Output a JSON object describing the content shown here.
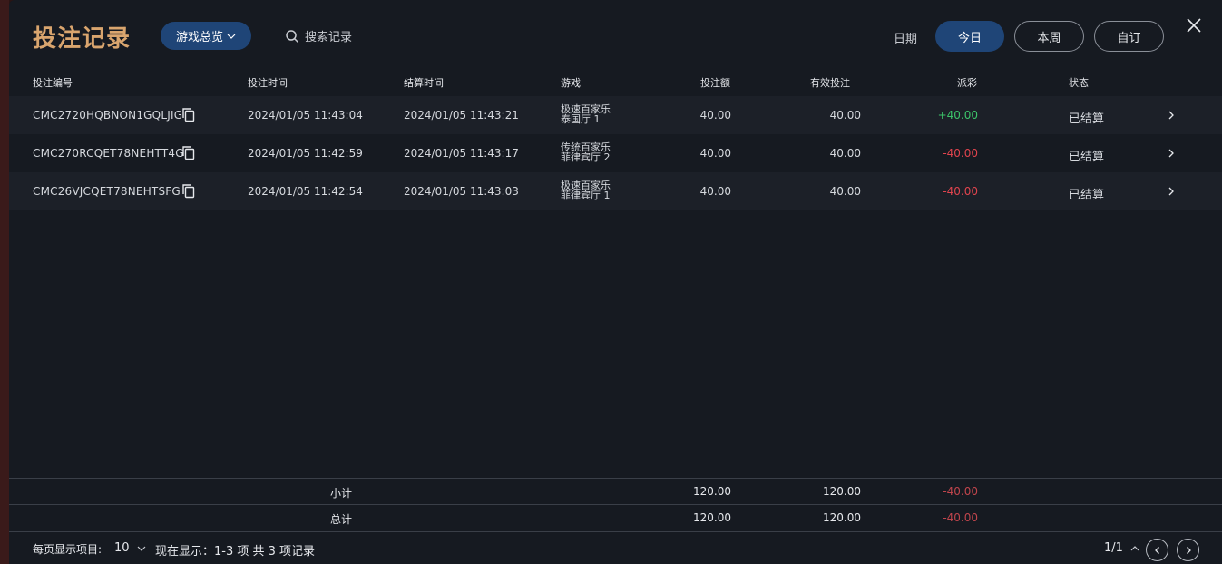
{
  "header": {
    "title": "投注记录",
    "game_filter": "游戏总览",
    "search_label": "搜索记录",
    "date_label": "日期",
    "date_today": "今日",
    "date_week": "本周",
    "date_custom": "自订"
  },
  "table": {
    "columns": [
      "投注编号",
      "投注时间",
      "结算时间",
      "游戏",
      "投注额",
      "有效投注",
      "派彩",
      "状态"
    ],
    "rows": [
      {
        "id": "CMC2720HQBNON1GQLJIG",
        "bet_time": "2024/01/05 11:43:04",
        "settle_time": "2024/01/05 11:43:21",
        "game_line1": "极速百家乐",
        "game_line2": "泰国厅 1",
        "amount": "40.00",
        "effective": "40.00",
        "payout": "+40.00",
        "status": "已结算"
      },
      {
        "id": "CMC270RCQET78NEHTT4G",
        "bet_time": "2024/01/05 11:42:59",
        "settle_time": "2024/01/05 11:43:17",
        "game_line1": "传统百家乐",
        "game_line2": "菲律宾厅 2",
        "amount": "40.00",
        "effective": "40.00",
        "payout": "-40.00",
        "status": "已结算"
      },
      {
        "id": "CMC26VJCQET78NEHTSFG",
        "bet_time": "2024/01/05 11:42:54",
        "settle_time": "2024/01/05 11:43:03",
        "game_line1": "极速百家乐",
        "game_line2": "菲律宾厅 1",
        "amount": "40.00",
        "effective": "40.00",
        "payout": "-40.00",
        "status": "已结算"
      }
    ]
  },
  "subtotal": {
    "label": "小计",
    "amount": "120.00",
    "effective": "120.00",
    "payout": "-40.00"
  },
  "total": {
    "label": "总计",
    "amount": "120.00",
    "effective": "120.00",
    "payout": "-40.00"
  },
  "footer": {
    "per_page_label": "每页显示项目:",
    "per_page_value": "10",
    "showing": "现在显示：1-3 项 共 3 项记录",
    "page": "1/1"
  },
  "colors": {
    "accent": "#1f4577",
    "title": "#d9a56e",
    "positive": "#3cc46a",
    "negative": "#e0444e"
  },
  "icons": {
    "search": "search-icon",
    "close": "close-icon",
    "copy": "copy-icon",
    "row_open": "chevron-right-icon"
  }
}
